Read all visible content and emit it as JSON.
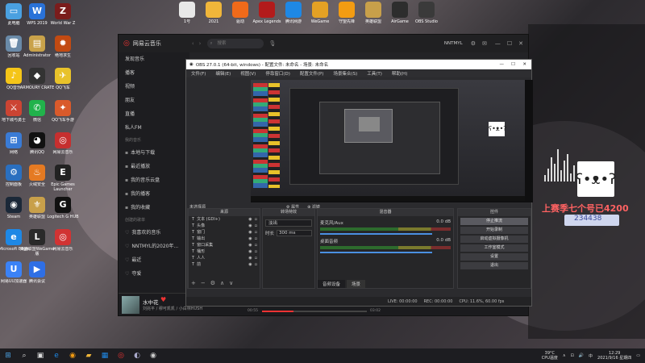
{
  "desktop_left": [
    {
      "label": "此电脑",
      "icon": "computer-icon",
      "color": "#4aa0e0",
      "glyph": "▭"
    },
    {
      "label": "回收站",
      "icon": "recycle-bin-icon",
      "color": "#6a8aa8",
      "glyph": "🗑"
    },
    {
      "label": "QQ音乐",
      "icon": "qq-music-icon",
      "color": "#f5c518",
      "glyph": "♪"
    },
    {
      "label": "地下城与勇士",
      "icon": "dnf-icon",
      "color": "#c43",
      "glyph": "⚔"
    },
    {
      "label": "网络",
      "icon": "network-icon",
      "color": "#3a7bd5",
      "glyph": "⊞"
    },
    {
      "label": "控制面板",
      "icon": "control-panel-icon",
      "color": "#2a6fbf",
      "glyph": "⚙"
    },
    {
      "label": "Steam",
      "icon": "steam-icon",
      "color": "#1b2838",
      "glyph": "◉"
    },
    {
      "label": "Microsoft Edge",
      "icon": "edge-icon",
      "color": "#1e88e5",
      "glyph": "e"
    },
    {
      "label": "网易UU加速器",
      "icon": "uu-icon",
      "color": "#3b82f6",
      "glyph": "U"
    }
  ],
  "desktop_col2": [
    {
      "label": "WPS 2019",
      "icon": "wps-icon",
      "color": "#2a72d8",
      "glyph": "W"
    },
    {
      "label": "Administrator",
      "icon": "user-folder-icon",
      "color": "#c9a24a",
      "glyph": "▤"
    },
    {
      "label": "ARMOURY CRATE",
      "icon": "armoury-icon",
      "color": "#333",
      "glyph": "◆"
    },
    {
      "label": "微信",
      "icon": "wechat-icon",
      "color": "#21b24b",
      "glyph": "✆"
    },
    {
      "label": "腾讯QQ",
      "icon": "qq-icon",
      "color": "#111",
      "glyph": "◕"
    },
    {
      "label": "火绒安全",
      "icon": "huorong-icon",
      "color": "#e57a22",
      "glyph": "♨"
    },
    {
      "label": "英雄联盟",
      "icon": "lol-icon",
      "color": "#c8a04a",
      "glyph": "⚜"
    },
    {
      "label": "英雄联盟WeGame版",
      "icon": "lol-wegame-icon",
      "color": "#2a2a2a",
      "glyph": "L"
    },
    {
      "label": "腾讯会议",
      "icon": "meeting-icon",
      "color": "#2f6fe5",
      "glyph": "▶"
    }
  ],
  "desktop_col3": [
    {
      "label": "World War Z",
      "icon": "wwz-icon",
      "color": "#7a1c1c",
      "glyph": "Z"
    },
    {
      "label": "绝地求生",
      "icon": "pubg-icon",
      "color": "#c24a12",
      "glyph": "✹"
    },
    {
      "label": "QQ飞车",
      "icon": "qq-speed-icon",
      "color": "#e8c22a",
      "glyph": "✈"
    },
    {
      "label": "QQ飞车手游",
      "icon": "qq-speed-mobile-icon",
      "color": "#d95a2b",
      "glyph": "✦"
    },
    {
      "label": "网易云音乐",
      "icon": "netease-music-icon",
      "color": "#c62f2f",
      "glyph": "◎"
    },
    {
      "label": "Epic Games Launcher",
      "icon": "epic-icon",
      "color": "#222",
      "glyph": "E"
    },
    {
      "label": "Logitech G HUB",
      "icon": "ghub-icon",
      "color": "#111",
      "glyph": "G"
    },
    {
      "label": "网易云音乐",
      "icon": "netease-music-icon",
      "color": "#d13333",
      "glyph": "◎"
    }
  ],
  "top_icons": [
    {
      "label": "1号",
      "icon": "doc-icon",
      "color": "#e8e8e8"
    },
    {
      "label": "2021",
      "icon": "folder-icon",
      "color": "#f0b63a"
    },
    {
      "label": "驱动",
      "icon": "orange-app-icon",
      "color": "#f06a1a"
    },
    {
      "label": "Apex Legends",
      "icon": "apex-icon",
      "color": "#b31b1b"
    },
    {
      "label": "腾讯网游",
      "icon": "game-accel-icon",
      "color": "#1e88e5"
    },
    {
      "label": "WeGame",
      "icon": "wegame-icon",
      "color": "#e4a124"
    },
    {
      "label": "守望先锋",
      "icon": "overwatch-icon",
      "color": "#f39c12"
    },
    {
      "label": "英雄联盟",
      "icon": "lol-icon",
      "color": "#c8a04a"
    },
    {
      "label": "AirGame",
      "icon": "airgame-icon",
      "color": "#2d2d2d"
    },
    {
      "label": "OBS Studio",
      "icon": "obs-icon",
      "color": "#3a3a3a"
    }
  ],
  "music": {
    "app_name": "网易云音乐",
    "search_placeholder": "搜索",
    "user": "NNTMYL",
    "side_items": [
      "发现音乐",
      "播客",
      "视频",
      "朋友",
      "直播",
      "私人FM"
    ],
    "my_music_head": "我的音乐",
    "my_items": [
      "本地与下载",
      "最近播放",
      "我的音乐云盘",
      "我的播客",
      "我的收藏"
    ],
    "created_head": "创建的歌单",
    "created_items": [
      "我喜欢的音乐",
      "NNTMYL的2020年...",
      "最近",
      "夺爱"
    ],
    "song": "水中花",
    "artist": "刘兆平 / 穆可凯凯 / 小白林HUSH",
    "time_cur": "00:55",
    "time_total": "03:02"
  },
  "obs": {
    "title": "OBS 27.0.1 (64-bit, windows) - 配置文件: 未命名 - 场景: 未命名",
    "menu": [
      "文件(F)",
      "编辑(E)",
      "视图(V)",
      "停靠窗口(D)",
      "配置文件(P)",
      "场景集合(S)",
      "工具(T)",
      "帮助(H)"
    ],
    "no_source": "未选择源",
    "props_btn": "属性",
    "filter_btn": "滤镜",
    "docks": {
      "scenes": "场景",
      "sources": "来源",
      "transitions": "转场特效",
      "mixer": "混音器",
      "controls": "控件"
    },
    "sources": [
      "文本 (GDI+)",
      "头像",
      "窗门",
      "输出",
      "窗口采集",
      "桶形",
      "人人",
      "前"
    ],
    "transition_value": "淡出",
    "duration_label": "时长",
    "duration_value": "300 ms",
    "mixer": [
      {
        "name": "麦克风/Aux",
        "db": "0.0 dB"
      },
      {
        "name": "桌面音频",
        "db": "0.0 dB"
      }
    ],
    "controls": [
      "停止推流",
      "开始录制",
      "启动虚拟摄像机",
      "工作室模式",
      "设置",
      "退出"
    ],
    "mixer_tabs": [
      "音频设备",
      "场景"
    ],
    "status": {
      "live": "LIVE: 00:00:00",
      "rec": "REC: 00:00:00",
      "cpu": "CPU: 11.6%, 60.00 fps"
    }
  },
  "overlay": {
    "text": "上赛季七个号已4200",
    "counter": "234438"
  },
  "tray": {
    "temp": "39°C",
    "cpu_label": "CPU温度",
    "time": "12:29",
    "date": "2021/9/16 星期四"
  }
}
